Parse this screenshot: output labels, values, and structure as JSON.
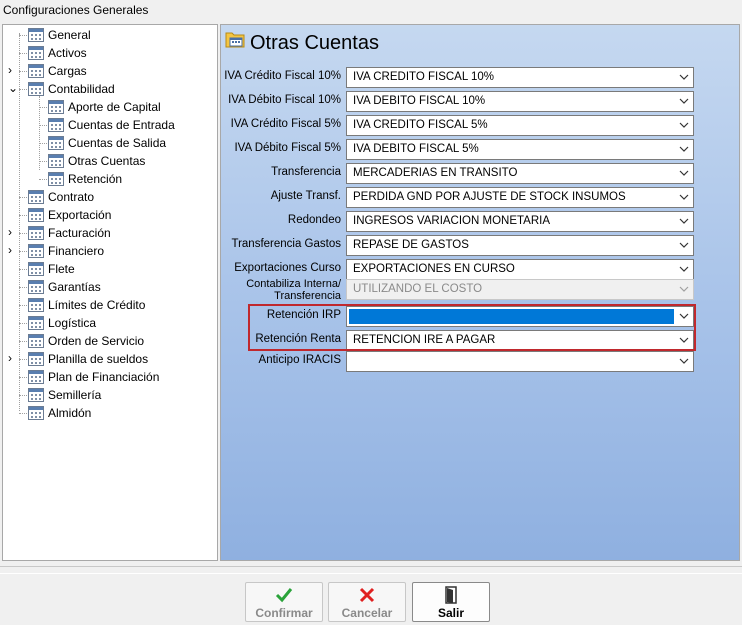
{
  "window": {
    "title": "Configuraciones Generales"
  },
  "tree": {
    "items": [
      {
        "label": "General",
        "expander": ""
      },
      {
        "label": "Activos",
        "expander": ""
      },
      {
        "label": "Cargas",
        "expander": "›"
      },
      {
        "label": "Contabilidad",
        "expander": "⌄"
      },
      {
        "label": "Aporte de Capital",
        "expander": ""
      },
      {
        "label": "Cuentas de Entrada",
        "expander": ""
      },
      {
        "label": "Cuentas de Salida",
        "expander": ""
      },
      {
        "label": "Otras Cuentas",
        "expander": ""
      },
      {
        "label": "Retención",
        "expander": ""
      },
      {
        "label": "Contrato",
        "expander": ""
      },
      {
        "label": "Exportación",
        "expander": ""
      },
      {
        "label": "Facturación",
        "expander": "›"
      },
      {
        "label": "Financiero",
        "expander": "›"
      },
      {
        "label": "Flete",
        "expander": ""
      },
      {
        "label": "Garantías",
        "expander": ""
      },
      {
        "label": "Límites de Crédito",
        "expander": ""
      },
      {
        "label": "Logística",
        "expander": ""
      },
      {
        "label": "Orden de Servicio",
        "expander": ""
      },
      {
        "label": "Planilla de sueldos",
        "expander": "›"
      },
      {
        "label": "Plan de Financiación",
        "expander": ""
      },
      {
        "label": "Semillería",
        "expander": ""
      },
      {
        "label": "Almidón",
        "expander": ""
      }
    ]
  },
  "panel": {
    "title": "Otras Cuentas",
    "rows": [
      {
        "label": "IVA Crédito Fiscal 10%",
        "value": "IVA CREDITO FISCAL 10%"
      },
      {
        "label": "IVA Débito Fiscal 10%",
        "value": "IVA DEBITO FISCAL 10%"
      },
      {
        "label": "IVA Crédito Fiscal 5%",
        "value": "IVA CREDITO FISCAL 5%"
      },
      {
        "label": "IVA Débito Fiscal 5%",
        "value": "IVA DEBITO FISCAL 5%"
      },
      {
        "label": "Transferencia",
        "value": "MERCADERIAS EN TRANSITO"
      },
      {
        "label": "Ajuste Transf.",
        "value": "PERDIDA GND POR AJUSTE DE STOCK INSUMOS"
      },
      {
        "label": "Redondeo",
        "value": "INGRESOS VARIACION MONETARIA"
      },
      {
        "label": "Transferencia Gastos",
        "value": "REPASE DE GASTOS"
      },
      {
        "label": "Exportaciones Curso",
        "value": "EXPORTACIONES EN CURSO"
      },
      {
        "label": "Contabiliza Interna/ Transferencia",
        "value": "UTILIZANDO EL COSTO"
      },
      {
        "label": "Retención IRP",
        "value": ""
      },
      {
        "label": "Retención Renta",
        "value": "RETENCION IRE A PAGAR"
      },
      {
        "label": "Anticipo IRACIS",
        "value": ""
      }
    ]
  },
  "buttons": {
    "confirm": "Confirmar",
    "cancel": "Cancelar",
    "exit": "Salir"
  },
  "colors": {
    "highlight_border": "#c0282d",
    "selection": "#0078d7",
    "panel_gradient_top": "#c5d8f0"
  }
}
